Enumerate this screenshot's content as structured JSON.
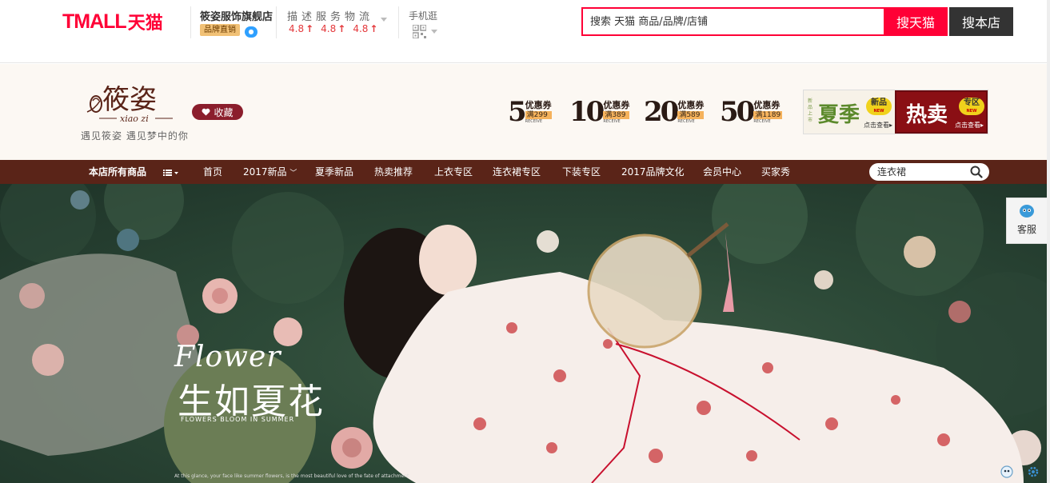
{
  "topbar": {
    "logo_latin": "TMALL",
    "logo_cn": "天猫",
    "shop_name": "筱姿服饰旗舰店",
    "shop_badge": "品牌直销",
    "rating_label": "描述服务物流",
    "ratings": [
      "4.8",
      "4.8",
      "4.8"
    ],
    "rating_arrow": "↑",
    "mobile_label": "手机逛",
    "search_placeholder": "搜索 天猫 商品/品牌/店铺",
    "search_tmall_label": "搜天猫",
    "search_shop_label": "搜本店"
  },
  "shop_header": {
    "brand_name": "筱姿",
    "brand_pinyin": "xiao zi",
    "slogan": "遇见筱姿 遇见梦中的你",
    "favorite_label": "收藏",
    "coupons": [
      {
        "amount": "5",
        "label": "优惠券",
        "condition": "满299",
        "tiny": "RECEIVE"
      },
      {
        "amount": "10",
        "label": "优惠券",
        "condition": "满389",
        "tiny": "RECEIVE"
      },
      {
        "amount": "20",
        "label": "优惠券",
        "condition": "满589",
        "tiny": "RECEIVE"
      },
      {
        "amount": "50",
        "label": "优惠券",
        "condition": "满1189",
        "tiny": "RECEIVE"
      }
    ],
    "promo_a": {
      "side": "新品上市",
      "title": "夏季",
      "tag": "新品",
      "tag_en": "NEW",
      "link": "点击查看▸"
    },
    "promo_b": {
      "title": "热卖",
      "tag": "专区",
      "tag_en": "NEW",
      "link": "点击查看▸"
    }
  },
  "nav": {
    "items": [
      "本店所有商品",
      "首页",
      "2017新品",
      "夏季新品",
      "热卖推荐",
      "上衣专区",
      "连衣裙专区",
      "下装专区",
      "2017品牌文化",
      "会员中心",
      "买家秀"
    ],
    "search_placeholder": "连衣裙"
  },
  "banner": {
    "script": "Flower",
    "title": "生如夏花",
    "subtitle": "FLOWERS BLOOM IN SUMMER",
    "caption": "At this glance, your face like summer flowers, is the most beautiful love of the fate of attachment"
  },
  "service": {
    "label": "客服"
  },
  "colors": {
    "tmall_red": "#ff0036",
    "nav_brown": "#5a2418",
    "fav_red": "#8b1e2c",
    "header_bg": "#fcf8f3"
  }
}
